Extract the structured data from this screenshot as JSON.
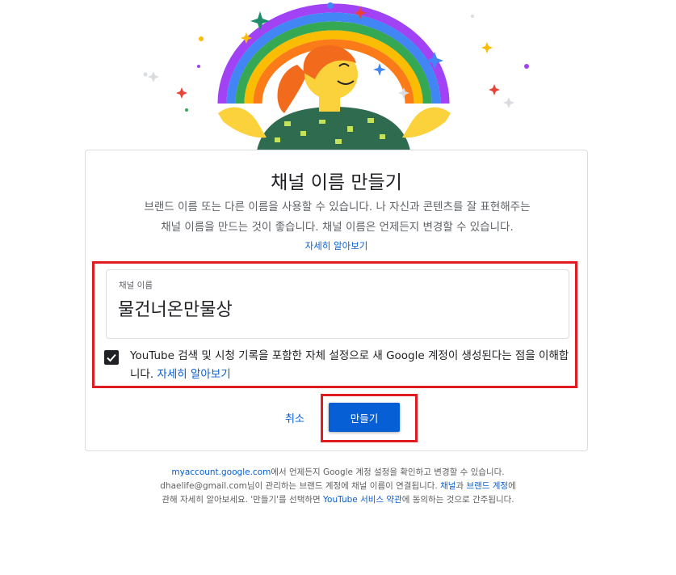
{
  "colors": {
    "accent": "#065fd4",
    "highlight": "#e01b22",
    "rainbow": [
      "#a142f4",
      "#4285f4",
      "#34a853",
      "#fbbc04",
      "#fa7b17"
    ]
  },
  "illustration": {
    "icon": "rainbow-person-illustration"
  },
  "dialog": {
    "title": "채널 이름 만들기",
    "description_line1": "브랜드 이름 또는 다른 이름을 사용할 수 있습니다. 나 자신과 콘텐츠를 잘 표현해주는",
    "description_line2": "채널 이름을 만드는 것이 좋습니다. 채널 이름은 언제든지 변경할 수 있습니다.",
    "learn_more": "자세히 알아보기",
    "input": {
      "label": "채널 이름",
      "value": "물건너온만물상"
    },
    "checkbox": {
      "checked": true,
      "text": "YouTube 검색 및 시청 기록을 포함한 자체 설정으로 새 Google 계정이 생성된다는 점을 이해합니다.",
      "link": "자세히 알아보기"
    },
    "cancel_label": "취소",
    "create_label": "만들기"
  },
  "footer": {
    "link_account": "myaccount.google.com",
    "text1": "에서 언제든지 Google 계정 설정을 확인하고 변경할 수 있습니다.",
    "text2": "dhaelife@gmail.com님이 관리하는 브랜드 계정에 채널 이름이 연결됩니다. ",
    "link_channel": "채널",
    "text3": "과 ",
    "link_brand": "브랜드 계정",
    "text4": "에",
    "text5": "관해 자세히 알아보세요. '만들기'를 선택하면 ",
    "link_terms": "YouTube 서비스 약관",
    "text6": "에 동의하는 것으로 간주됩니다."
  }
}
